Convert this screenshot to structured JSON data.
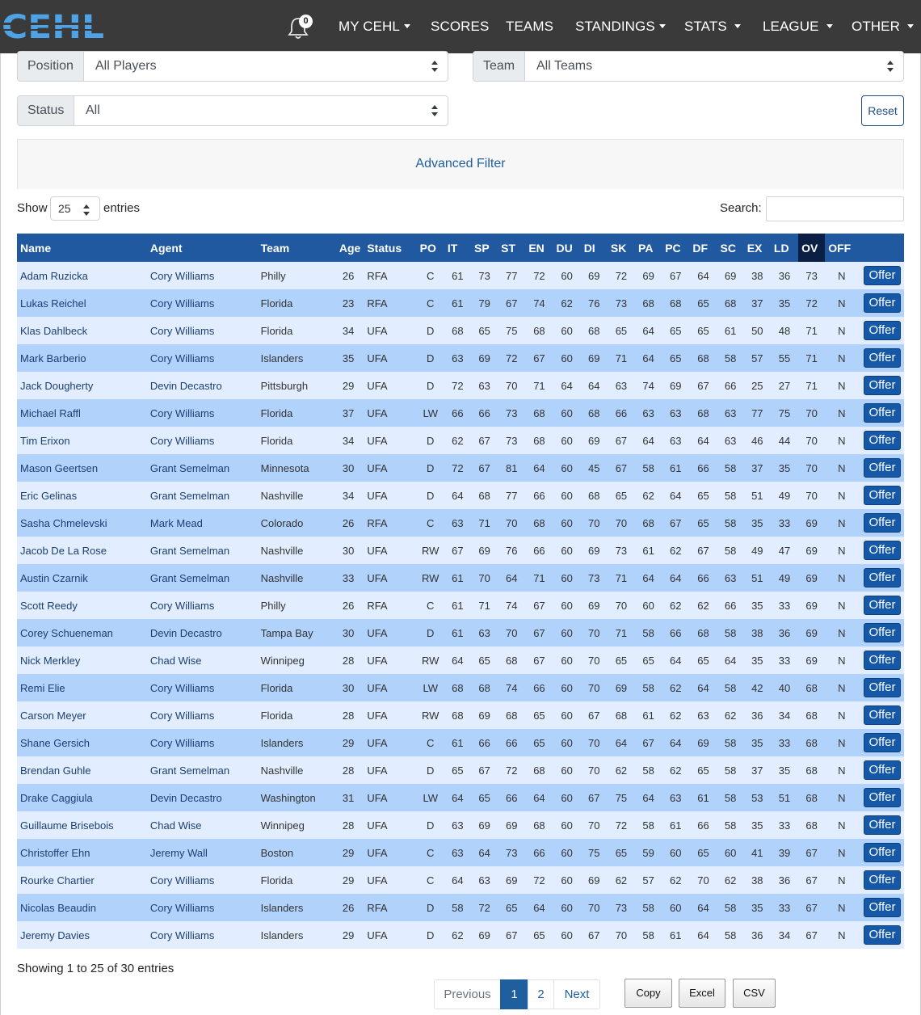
{
  "nav": {
    "logo_text": "CEHL",
    "notification_count": "0",
    "items": [
      "MY CEHL",
      "SCORES",
      "TEAMS",
      "STANDINGS",
      "STATS",
      "LEAGUE",
      "OTHER"
    ],
    "dropdowns": [
      true,
      false,
      false,
      true,
      true,
      true,
      true
    ]
  },
  "filters": {
    "position_label": "Position",
    "position_value": "All Players",
    "team_label": "Team",
    "team_value": "All Teams",
    "status_label": "Status",
    "status_value": "All",
    "reset_label": "Reset",
    "advanced_filter": "Advanced Filter"
  },
  "table_controls": {
    "show_label": "Show",
    "entries_value": "25",
    "entries_label": "entries",
    "search_label": "Search:"
  },
  "table": {
    "columns": [
      "Name",
      "Agent",
      "Team",
      "Age",
      "Status",
      "PO",
      "IT",
      "SP",
      "ST",
      "EN",
      "DU",
      "DI",
      "SK",
      "PA",
      "PC",
      "DF",
      "SC",
      "EX",
      "LD",
      "OV",
      "OFF",
      ""
    ],
    "offer_label": "Offer",
    "rows": [
      [
        "Adam Ruzicka",
        "Cory Williams",
        "Philly",
        "26",
        "RFA",
        "C",
        "61",
        "73",
        "77",
        "72",
        "60",
        "69",
        "72",
        "69",
        "67",
        "64",
        "69",
        "38",
        "36",
        "73",
        "N"
      ],
      [
        "Lukas Reichel",
        "Cory Williams",
        "Florida",
        "23",
        "RFA",
        "C",
        "61",
        "79",
        "67",
        "74",
        "62",
        "76",
        "73",
        "68",
        "68",
        "65",
        "68",
        "37",
        "35",
        "72",
        "N"
      ],
      [
        "Klas Dahlbeck",
        "Cory Williams",
        "Florida",
        "34",
        "UFA",
        "D",
        "68",
        "65",
        "75",
        "68",
        "60",
        "68",
        "65",
        "64",
        "65",
        "65",
        "61",
        "50",
        "48",
        "71",
        "N"
      ],
      [
        "Mark Barberio",
        "Cory Williams",
        "Islanders",
        "35",
        "UFA",
        "D",
        "63",
        "69",
        "72",
        "67",
        "60",
        "69",
        "71",
        "64",
        "65",
        "68",
        "58",
        "57",
        "55",
        "71",
        "N"
      ],
      [
        "Jack Dougherty",
        "Devin Decastro",
        "Pittsburgh",
        "29",
        "UFA",
        "D",
        "72",
        "63",
        "70",
        "71",
        "64",
        "64",
        "63",
        "74",
        "69",
        "67",
        "66",
        "25",
        "27",
        "71",
        "N"
      ],
      [
        "Michael Raffl",
        "Cory Williams",
        "Florida",
        "37",
        "UFA",
        "LW",
        "66",
        "66",
        "73",
        "68",
        "60",
        "68",
        "66",
        "63",
        "63",
        "68",
        "63",
        "77",
        "75",
        "70",
        "N"
      ],
      [
        "Tim Erixon",
        "Cory Williams",
        "Florida",
        "34",
        "UFA",
        "D",
        "62",
        "67",
        "73",
        "68",
        "60",
        "69",
        "67",
        "64",
        "63",
        "64",
        "63",
        "46",
        "44",
        "70",
        "N"
      ],
      [
        "Mason Geertsen",
        "Grant Semelman",
        "Minnesota",
        "30",
        "UFA",
        "D",
        "72",
        "67",
        "81",
        "64",
        "60",
        "45",
        "67",
        "58",
        "61",
        "66",
        "58",
        "37",
        "35",
        "70",
        "N"
      ],
      [
        "Eric Gelinas",
        "Grant Semelman",
        "Nashville",
        "34",
        "UFA",
        "D",
        "64",
        "68",
        "77",
        "66",
        "60",
        "68",
        "65",
        "62",
        "64",
        "65",
        "58",
        "51",
        "49",
        "70",
        "N"
      ],
      [
        "Sasha Chmelevski",
        "Mark Mead",
        "Colorado",
        "26",
        "RFA",
        "C",
        "63",
        "71",
        "70",
        "68",
        "60",
        "70",
        "70",
        "68",
        "67",
        "65",
        "58",
        "35",
        "33",
        "69",
        "N"
      ],
      [
        "Jacob De La Rose",
        "Grant Semelman",
        "Nashville",
        "30",
        "UFA",
        "RW",
        "67",
        "69",
        "76",
        "66",
        "60",
        "69",
        "73",
        "61",
        "62",
        "67",
        "58",
        "49",
        "47",
        "69",
        "N"
      ],
      [
        "Austin Czarnik",
        "Grant Semelman",
        "Nashville",
        "33",
        "UFA",
        "RW",
        "61",
        "70",
        "64",
        "71",
        "60",
        "73",
        "71",
        "64",
        "64",
        "66",
        "63",
        "51",
        "49",
        "69",
        "N"
      ],
      [
        "Scott Reedy",
        "Cory Williams",
        "Philly",
        "26",
        "RFA",
        "C",
        "61",
        "71",
        "74",
        "67",
        "60",
        "69",
        "70",
        "60",
        "62",
        "62",
        "66",
        "35",
        "33",
        "69",
        "N"
      ],
      [
        "Corey Schueneman",
        "Devin Decastro",
        "Tampa Bay",
        "30",
        "UFA",
        "D",
        "61",
        "63",
        "70",
        "67",
        "60",
        "70",
        "71",
        "58",
        "66",
        "68",
        "58",
        "38",
        "36",
        "69",
        "N"
      ],
      [
        "Nick Merkley",
        "Chad Wise",
        "Winnipeg",
        "28",
        "UFA",
        "RW",
        "64",
        "65",
        "68",
        "67",
        "60",
        "70",
        "65",
        "65",
        "64",
        "65",
        "64",
        "35",
        "33",
        "69",
        "N"
      ],
      [
        "Remi Elie",
        "Cory Williams",
        "Florida",
        "30",
        "UFA",
        "LW",
        "68",
        "68",
        "74",
        "66",
        "60",
        "70",
        "69",
        "58",
        "62",
        "64",
        "58",
        "42",
        "40",
        "68",
        "N"
      ],
      [
        "Carson Meyer",
        "Cory Williams",
        "Florida",
        "28",
        "UFA",
        "RW",
        "68",
        "69",
        "68",
        "65",
        "60",
        "67",
        "68",
        "61",
        "62",
        "63",
        "62",
        "36",
        "34",
        "68",
        "N"
      ],
      [
        "Shane Gersich",
        "Cory Williams",
        "Islanders",
        "29",
        "UFA",
        "C",
        "61",
        "66",
        "66",
        "65",
        "60",
        "70",
        "64",
        "67",
        "64",
        "69",
        "58",
        "35",
        "33",
        "68",
        "N"
      ],
      [
        "Brendan Guhle",
        "Grant Semelman",
        "Nashville",
        "28",
        "UFA",
        "D",
        "65",
        "67",
        "72",
        "68",
        "60",
        "70",
        "62",
        "58",
        "62",
        "65",
        "58",
        "37",
        "35",
        "68",
        "N"
      ],
      [
        "Drake Caggiula",
        "Devin Decastro",
        "Washington",
        "31",
        "UFA",
        "LW",
        "64",
        "65",
        "66",
        "64",
        "60",
        "67",
        "75",
        "64",
        "63",
        "61",
        "58",
        "53",
        "51",
        "68",
        "N"
      ],
      [
        "Guillaume Brisebois",
        "Chad Wise",
        "Winnipeg",
        "28",
        "UFA",
        "D",
        "63",
        "69",
        "69",
        "68",
        "60",
        "70",
        "72",
        "58",
        "61",
        "66",
        "58",
        "35",
        "33",
        "68",
        "N"
      ],
      [
        "Christoffer Ehn",
        "Jeremy Wall",
        "Boston",
        "29",
        "UFA",
        "C",
        "63",
        "64",
        "73",
        "66",
        "60",
        "75",
        "65",
        "59",
        "60",
        "65",
        "60",
        "41",
        "39",
        "67",
        "N"
      ],
      [
        "Rourke Chartier",
        "Cory Williams",
        "Florida",
        "29",
        "UFA",
        "C",
        "64",
        "63",
        "69",
        "72",
        "60",
        "69",
        "62",
        "57",
        "62",
        "70",
        "62",
        "38",
        "36",
        "67",
        "N"
      ],
      [
        "Nicolas Beaudin",
        "Cory Williams",
        "Islanders",
        "26",
        "RFA",
        "D",
        "58",
        "72",
        "65",
        "64",
        "60",
        "70",
        "73",
        "58",
        "60",
        "64",
        "58",
        "35",
        "33",
        "67",
        "N"
      ],
      [
        "Jeremy Davies",
        "Cory Williams",
        "Islanders",
        "29",
        "UFA",
        "D",
        "62",
        "69",
        "67",
        "65",
        "60",
        "67",
        "70",
        "58",
        "61",
        "64",
        "58",
        "36",
        "34",
        "67",
        "N"
      ]
    ]
  },
  "footer": {
    "showing": "Showing 1 to 25 of 30 entries",
    "previous": "Previous",
    "page1": "1",
    "page2": "2",
    "next": "Next",
    "copy": "Copy",
    "excel": "Excel",
    "csv": "CSV"
  },
  "colors": {
    "navbar": "#3a3a3a",
    "logo": "#4da3e6",
    "header": "#2159a0",
    "row_light": "#e2eeff",
    "row_dark": "#b1d2fb",
    "offer_button": "#1558a8"
  }
}
